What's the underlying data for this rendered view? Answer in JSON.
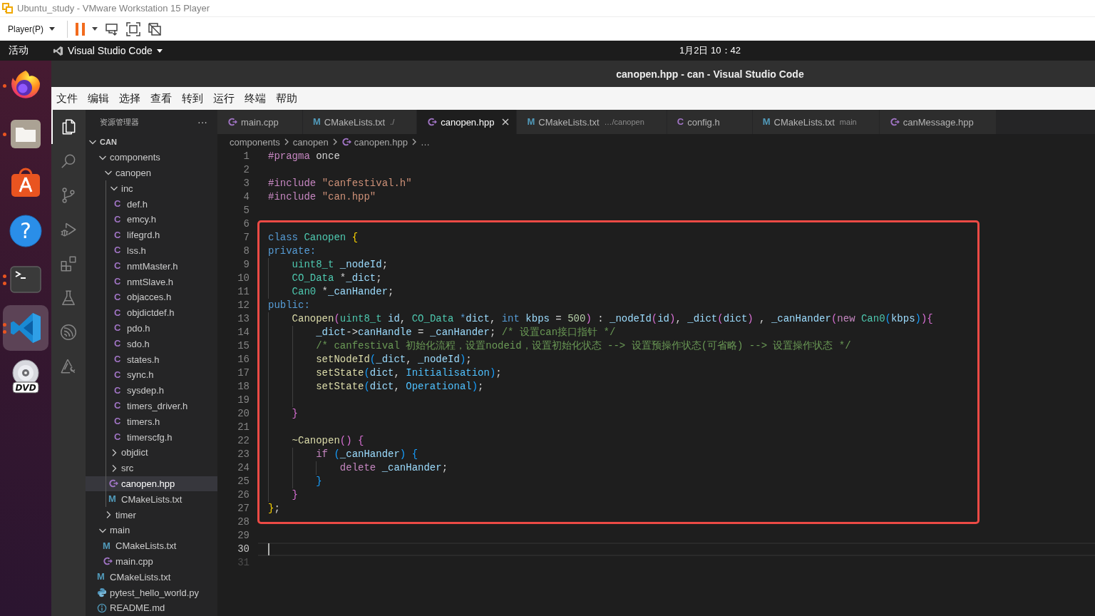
{
  "vm_window": {
    "title": "Ubuntu_study - VMware Workstation 15 Player"
  },
  "vm_toolbar": {
    "player_menu": {
      "label": "Player(P)"
    },
    "tools": [
      {
        "kind": "pause",
        "dropdown": true
      },
      {
        "kind": "send-keys",
        "dropdown": false
      },
      {
        "kind": "fullscreen",
        "dropdown": false
      },
      {
        "kind": "unity",
        "dropdown": false
      }
    ]
  },
  "top_bar": {
    "activities": "活动",
    "app_menu": {
      "label": "Visual Studio Code"
    },
    "clock": "1月2日 10：42"
  },
  "dock": [
    {
      "kind": "browser",
      "running": true,
      "multiple_windows": false,
      "selected": false
    },
    {
      "kind": "files",
      "running": true,
      "multiple_windows": false,
      "selected": false
    },
    {
      "kind": "store",
      "running": false,
      "selected": false
    },
    {
      "kind": "help",
      "glyph": "?",
      "running": false,
      "selected": false
    },
    {
      "kind": "terminal",
      "running": true,
      "multiple_windows": true,
      "selected": false
    },
    {
      "kind": "editor",
      "running": true,
      "multiple_windows": true,
      "selected": true
    },
    {
      "kind": "disc",
      "label": "DVD",
      "running": false,
      "selected": false
    }
  ],
  "vscode": {
    "title": "canopen.hpp - can - Visual Studio Code",
    "menu": [
      "文件",
      "编辑",
      "选择",
      "查看",
      "转到",
      "运行",
      "终端",
      "帮助"
    ],
    "activity_bar": [
      {
        "kind": "explorer",
        "selected": true
      },
      {
        "kind": "search",
        "selected": false
      },
      {
        "kind": "source-control",
        "selected": false
      },
      {
        "kind": "run-debug",
        "selected": false
      },
      {
        "kind": "extensions",
        "selected": false
      },
      {
        "kind": "testing",
        "selected": false
      },
      {
        "kind": "wave",
        "selected": false
      },
      {
        "kind": "triangle-tool",
        "selected": false
      }
    ],
    "explorer": {
      "title": "资源管理器",
      "more": "···",
      "tree": [
        {
          "name": "CAN",
          "kind": "root",
          "expanded": true,
          "selected": false,
          "children": [
            {
              "name": "components",
              "kind": "folder",
              "expanded": true,
              "selected": false,
              "children": [
                {
                  "name": "canopen",
                  "kind": "folder",
                  "expanded": true,
                  "selected": false,
                  "children": [
                    {
                      "name": "inc",
                      "kind": "folder",
                      "expanded": true,
                      "selected": false,
                      "children": [
                        {
                          "name": "def.h",
                          "kind": "c-header",
                          "glyph": "C",
                          "selected": false
                        },
                        {
                          "name": "emcy.h",
                          "kind": "c-header",
                          "glyph": "C",
                          "selected": false
                        },
                        {
                          "name": "lifegrd.h",
                          "kind": "c-header",
                          "glyph": "C",
                          "selected": false
                        },
                        {
                          "name": "lss.h",
                          "kind": "c-header",
                          "glyph": "C",
                          "selected": false
                        },
                        {
                          "name": "nmtMaster.h",
                          "kind": "c-header",
                          "glyph": "C",
                          "selected": false
                        },
                        {
                          "name": "nmtSlave.h",
                          "kind": "c-header",
                          "glyph": "C",
                          "selected": false
                        },
                        {
                          "name": "objacces.h",
                          "kind": "c-header",
                          "glyph": "C",
                          "selected": false
                        },
                        {
                          "name": "objdictdef.h",
                          "kind": "c-header",
                          "glyph": "C",
                          "selected": false
                        },
                        {
                          "name": "pdo.h",
                          "kind": "c-header",
                          "glyph": "C",
                          "selected": false
                        },
                        {
                          "name": "sdo.h",
                          "kind": "c-header",
                          "glyph": "C",
                          "selected": false
                        },
                        {
                          "name": "states.h",
                          "kind": "c-header",
                          "glyph": "C",
                          "selected": false
                        },
                        {
                          "name": "sync.h",
                          "kind": "c-header",
                          "glyph": "C",
                          "selected": false
                        },
                        {
                          "name": "sysdep.h",
                          "kind": "c-header",
                          "glyph": "C",
                          "selected": false
                        },
                        {
                          "name": "timers_driver.h",
                          "kind": "c-header",
                          "glyph": "C",
                          "selected": false
                        },
                        {
                          "name": "timers.h",
                          "kind": "c-header",
                          "glyph": "C",
                          "selected": false
                        },
                        {
                          "name": "timerscfg.h",
                          "kind": "c-header",
                          "glyph": "C",
                          "selected": false
                        }
                      ]
                    },
                    {
                      "name": "objdict",
                      "kind": "folder",
                      "expanded": false,
                      "selected": false
                    },
                    {
                      "name": "src",
                      "kind": "folder",
                      "expanded": false,
                      "selected": false
                    },
                    {
                      "name": "canopen.hpp",
                      "kind": "cpp",
                      "selected": true
                    },
                    {
                      "name": "CMakeLists.txt",
                      "kind": "cmake",
                      "glyph": "M",
                      "selected": false
                    }
                  ]
                },
                {
                  "name": "timer",
                  "kind": "folder",
                  "expanded": false,
                  "selected": false
                }
              ]
            },
            {
              "name": "main",
              "kind": "folder",
              "expanded": true,
              "selected": false,
              "children": [
                {
                  "name": "CMakeLists.txt",
                  "kind": "cmake",
                  "glyph": "M",
                  "selected": false
                },
                {
                  "name": "main.cpp",
                  "kind": "cpp",
                  "selected": false
                }
              ]
            },
            {
              "name": "CMakeLists.txt",
              "kind": "cmake",
              "glyph": "M",
              "selected": false
            },
            {
              "name": "pytest_hello_world.py",
              "kind": "python",
              "selected": false
            },
            {
              "name": "README.md",
              "kind": "info",
              "selected": false
            }
          ]
        }
      ]
    },
    "tabs": [
      {
        "label": "main.cpp",
        "kind": "cpp",
        "selected": false
      },
      {
        "label": "CMakeLists.txt",
        "description": "./",
        "kind": "cmake",
        "glyph": "M",
        "selected": false
      },
      {
        "label": "canopen.hpp",
        "kind": "cpp",
        "selected": true
      },
      {
        "label": "CMakeLists.txt",
        "description": "…/canopen",
        "kind": "cmake",
        "glyph": "M",
        "selected": false
      },
      {
        "label": "config.h",
        "kind": "c-header",
        "glyph": "C",
        "selected": false
      },
      {
        "label": "CMakeLists.txt",
        "description": "main",
        "kind": "cmake",
        "glyph": "M",
        "selected": false
      },
      {
        "label": "canMessage.hpp",
        "kind": "cpp",
        "selected": false
      }
    ],
    "breadcrumb": [
      {
        "label": "components"
      },
      {
        "label": "canopen"
      },
      {
        "label": "canopen.hpp",
        "kind": "cpp"
      },
      {
        "label": "…"
      }
    ],
    "editor": {
      "blocks": [
        {
          "highlighted": false,
          "lines": [
            {
              "number": "1",
              "tokens": [
                {
                  "kind": "directive",
                  "text": "#pragma"
                },
                {
                  "kind": "plain",
                  "text": " once"
                }
              ],
              "current": false,
              "dimmed": false
            },
            {
              "number": "2",
              "current": false,
              "dimmed": false
            },
            {
              "number": "3",
              "tokens": [
                {
                  "kind": "directive",
                  "text": "#include "
                },
                {
                  "kind": "string",
                  "text": "\"canfestival.h\""
                }
              ],
              "current": false,
              "dimmed": false
            },
            {
              "number": "4",
              "tokens": [
                {
                  "kind": "directive",
                  "text": "#include "
                },
                {
                  "kind": "string",
                  "text": "\"can.hpp\""
                }
              ],
              "current": false,
              "dimmed": false
            },
            {
              "number": "5",
              "current": false,
              "dimmed": false
            },
            {
              "number": "6",
              "current": false,
              "dimmed": false
            }
          ]
        },
        {
          "highlighted": true,
          "lines": [
            {
              "number": "7",
              "tokens": [
                {
                  "kind": "keyword",
                  "text": "class "
                },
                {
                  "kind": "type",
                  "text": "Canopen "
                },
                {
                  "kind": "bracket1",
                  "text": "{"
                }
              ],
              "current": false,
              "dimmed": false
            },
            {
              "number": "8",
              "tokens": [
                {
                  "kind": "keyword",
                  "text": "private:"
                }
              ],
              "current": false,
              "dimmed": false
            },
            {
              "number": "9",
              "tokens": [
                {
                  "kind": "type",
                  "text": "    uint8_t "
                },
                {
                  "kind": "variable",
                  "text": "_nodeId"
                },
                {
                  "kind": "plain",
                  "text": ";"
                }
              ],
              "current": false,
              "dimmed": false
            },
            {
              "number": "10",
              "tokens": [
                {
                  "kind": "type",
                  "text": "    CO_Data"
                },
                {
                  "kind": "plain",
                  "text": " *"
                },
                {
                  "kind": "variable",
                  "text": "_dict"
                },
                {
                  "kind": "plain",
                  "text": ";"
                }
              ],
              "current": false,
              "dimmed": false
            },
            {
              "number": "11",
              "tokens": [
                {
                  "kind": "type",
                  "text": "    Can0"
                },
                {
                  "kind": "plain",
                  "text": " *"
                },
                {
                  "kind": "variable",
                  "text": "_canHander"
                },
                {
                  "kind": "plain",
                  "text": ";"
                }
              ],
              "current": false,
              "dimmed": false
            },
            {
              "number": "12",
              "tokens": [
                {
                  "kind": "keyword",
                  "text": "public:"
                }
              ],
              "current": false,
              "dimmed": false
            },
            {
              "number": "13",
              "tokens": [
                {
                  "kind": "function",
                  "text": "    Canopen"
                },
                {
                  "kind": "bracket2",
                  "text": "("
                },
                {
                  "kind": "type",
                  "text": "uint8_t "
                },
                {
                  "kind": "variable",
                  "text": "id"
                },
                {
                  "kind": "plain",
                  "text": ", "
                },
                {
                  "kind": "type",
                  "text": "CO_Data "
                },
                {
                  "kind": "keyword",
                  "text": "*"
                },
                {
                  "kind": "variable",
                  "text": "dict"
                },
                {
                  "kind": "plain",
                  "text": ", "
                },
                {
                  "kind": "keyword",
                  "text": "int "
                },
                {
                  "kind": "variable",
                  "text": "kbps"
                },
                {
                  "kind": "plain",
                  "text": " = "
                },
                {
                  "kind": "number",
                  "text": "500"
                },
                {
                  "kind": "bracket2",
                  "text": ")"
                },
                {
                  "kind": "plain",
                  "text": " : "
                },
                {
                  "kind": "variable",
                  "text": "_nodeId"
                },
                {
                  "kind": "bracket2",
                  "text": "("
                },
                {
                  "kind": "variable",
                  "text": "id"
                },
                {
                  "kind": "bracket2",
                  "text": ")"
                },
                {
                  "kind": "plain",
                  "text": ", "
                },
                {
                  "kind": "variable",
                  "text": "_dict"
                },
                {
                  "kind": "bracket2",
                  "text": "("
                },
                {
                  "kind": "variable",
                  "text": "dict"
                },
                {
                  "kind": "bracket2",
                  "text": ")"
                },
                {
                  "kind": "plain",
                  "text": " , "
                },
                {
                  "kind": "variable",
                  "text": "_canHander"
                },
                {
                  "kind": "bracket2",
                  "text": "("
                },
                {
                  "kind": "control",
                  "text": "new "
                },
                {
                  "kind": "type",
                  "text": "Can0"
                },
                {
                  "kind": "bracket3",
                  "text": "("
                },
                {
                  "kind": "variable",
                  "text": "kbps"
                },
                {
                  "kind": "bracket3",
                  "text": ")"
                },
                {
                  "kind": "bracket2",
                  "text": "){"
                }
              ],
              "current": false,
              "dimmed": false
            },
            {
              "number": "14",
              "tokens": [
                {
                  "kind": "variable",
                  "text": "        _dict"
                },
                {
                  "kind": "plain",
                  "text": "->"
                },
                {
                  "kind": "variable",
                  "text": "canHandle"
                },
                {
                  "kind": "plain",
                  "text": " = "
                },
                {
                  "kind": "variable",
                  "text": "_canHander"
                },
                {
                  "kind": "plain",
                  "text": "; "
                },
                {
                  "kind": "comment",
                  "text": "/* 设置can接口指针 */"
                }
              ],
              "current": false,
              "dimmed": false
            },
            {
              "number": "15",
              "tokens": [
                {
                  "kind": "comment",
                  "text": "        /* canfestival 初始化流程，设置nodeid，设置初始化状态 --> 设置预操作状态(可省略) --> 设置操作状态 */"
                }
              ],
              "current": false,
              "dimmed": false
            },
            {
              "number": "16",
              "tokens": [
                {
                  "kind": "function",
                  "text": "        setNodeId"
                },
                {
                  "kind": "bracket3",
                  "text": "("
                },
                {
                  "kind": "variable",
                  "text": "_dict"
                },
                {
                  "kind": "plain",
                  "text": ", "
                },
                {
                  "kind": "variable",
                  "text": "_nodeId"
                },
                {
                  "kind": "bracket3",
                  "text": ")"
                },
                {
                  "kind": "plain",
                  "text": ";"
                }
              ],
              "current": false,
              "dimmed": false
            },
            {
              "number": "17",
              "tokens": [
                {
                  "kind": "function",
                  "text": "        setState"
                },
                {
                  "kind": "bracket3",
                  "text": "("
                },
                {
                  "kind": "variable",
                  "text": "dict"
                },
                {
                  "kind": "plain",
                  "text": ", "
                },
                {
                  "kind": "constant",
                  "text": "Initialisation"
                },
                {
                  "kind": "bracket3",
                  "text": ")"
                },
                {
                  "kind": "plain",
                  "text": ";"
                }
              ],
              "current": false,
              "dimmed": false
            },
            {
              "number": "18",
              "tokens": [
                {
                  "kind": "function",
                  "text": "        setState"
                },
                {
                  "kind": "bracket3",
                  "text": "("
                },
                {
                  "kind": "variable",
                  "text": "dict"
                },
                {
                  "kind": "plain",
                  "text": ", "
                },
                {
                  "kind": "constant",
                  "text": "Operational"
                },
                {
                  "kind": "bracket3",
                  "text": ")"
                },
                {
                  "kind": "plain",
                  "text": ";"
                }
              ],
              "current": false,
              "dimmed": false
            },
            {
              "number": "19",
              "current": false,
              "dimmed": false
            },
            {
              "number": "20",
              "tokens": [
                {
                  "kind": "bracket2",
                  "text": "    }"
                }
              ],
              "current": false,
              "dimmed": false
            },
            {
              "number": "21",
              "current": false,
              "dimmed": false
            },
            {
              "number": "22",
              "tokens": [
                {
                  "kind": "function",
                  "text": "    ~Canopen"
                },
                {
                  "kind": "bracket2",
                  "text": "() {"
                }
              ],
              "current": false,
              "dimmed": false
            },
            {
              "number": "23",
              "tokens": [
                {
                  "kind": "control",
                  "text": "        if "
                },
                {
                  "kind": "bracket3",
                  "text": "("
                },
                {
                  "kind": "variable",
                  "text": "_canHander"
                },
                {
                  "kind": "bracket3",
                  "text": ") {"
                }
              ],
              "current": false,
              "dimmed": false
            },
            {
              "number": "24",
              "tokens": [
                {
                  "kind": "control",
                  "text": "            delete "
                },
                {
                  "kind": "variable",
                  "text": "_canHander"
                },
                {
                  "kind": "plain",
                  "text": ";"
                }
              ],
              "current": false,
              "dimmed": false
            },
            {
              "number": "25",
              "tokens": [
                {
                  "kind": "bracket3",
                  "text": "        }"
                }
              ],
              "current": false,
              "dimmed": false
            },
            {
              "number": "26",
              "tokens": [
                {
                  "kind": "bracket2",
                  "text": "    }"
                }
              ],
              "current": false,
              "dimmed": false
            },
            {
              "number": "27",
              "tokens": [
                {
                  "kind": "bracket1",
                  "text": "}"
                },
                {
                  "kind": "plain",
                  "text": ";"
                }
              ],
              "current": false,
              "dimmed": false
            }
          ]
        },
        {
          "highlighted": false,
          "lines": [
            {
              "number": "28",
              "current": false,
              "dimmed": false
            },
            {
              "number": "29",
              "current": false,
              "dimmed": false
            },
            {
              "number": "30",
              "current": true,
              "dimmed": false
            },
            {
              "number": "31",
              "current": false,
              "dimmed": true
            }
          ]
        }
      ]
    }
  }
}
